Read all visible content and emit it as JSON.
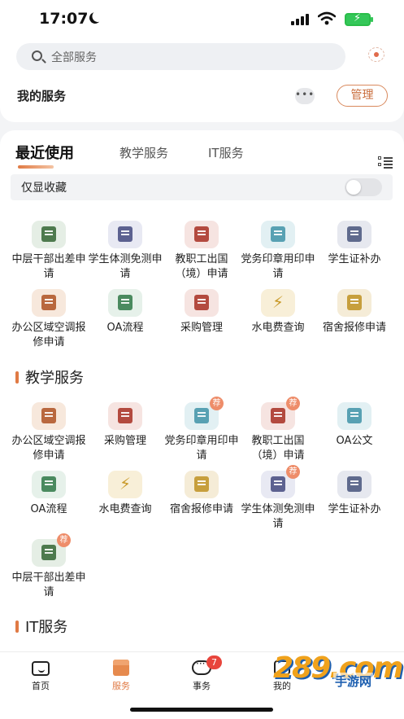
{
  "status_bar": {
    "time": "17:07"
  },
  "search": {
    "placeholder": "全部服务"
  },
  "my_services": {
    "title": "我的服务",
    "more": "•••",
    "manage_label": "管理"
  },
  "tabs": {
    "items": [
      "最近使用",
      "教学服务",
      "IT服务"
    ]
  },
  "favorites_only": {
    "label": "仅显收藏",
    "enabled": false
  },
  "recent": [
    {
      "label": "中层干部出差申请",
      "icon": "business-trip-icon",
      "recommended": false
    },
    {
      "label": "学生体测免测申请",
      "icon": "physical-test-icon",
      "recommended": false
    },
    {
      "label": "教职工出国（境）申请",
      "icon": "airplane-icon",
      "recommended": false
    },
    {
      "label": "党务印章用印申请",
      "icon": "seal-icon",
      "recommended": false
    },
    {
      "label": "学生证补办",
      "icon": "id-card-icon",
      "recommended": false
    },
    {
      "label": "办公区域空调报修申请",
      "icon": "repair-form-icon",
      "recommended": false
    },
    {
      "label": "OA流程",
      "icon": "oa-flow-icon",
      "recommended": false
    },
    {
      "label": "采购管理",
      "icon": "purchase-icon",
      "recommended": false
    },
    {
      "label": "水电费查询",
      "icon": "lightning-icon",
      "recommended": false
    },
    {
      "label": "宿舍报修申请",
      "icon": "dormitory-icon",
      "recommended": false
    }
  ],
  "teaching_section": {
    "title": "教学服务",
    "badge_text": "荐",
    "items": [
      {
        "label": "办公区域空调报修申请",
        "icon": "repair-form-icon",
        "recommended": false
      },
      {
        "label": "采购管理",
        "icon": "purchase-icon",
        "recommended": false
      },
      {
        "label": "党务印章用印申请",
        "icon": "seal-icon",
        "recommended": true
      },
      {
        "label": "教职工出国（境）申请",
        "icon": "airplane-icon",
        "recommended": true
      },
      {
        "label": "OA公文",
        "icon": "oa-document-icon",
        "recommended": false
      },
      {
        "label": "OA流程",
        "icon": "oa-flow-icon",
        "recommended": false
      },
      {
        "label": "水电费查询",
        "icon": "lightning-icon",
        "recommended": false
      },
      {
        "label": "宿舍报修申请",
        "icon": "dormitory-icon",
        "recommended": false
      },
      {
        "label": "学生体测免测申请",
        "icon": "physical-test-icon",
        "recommended": true
      },
      {
        "label": "学生证补办",
        "icon": "id-card-icon",
        "recommended": false
      },
      {
        "label": "中层干部出差申请",
        "icon": "business-trip-icon",
        "recommended": true
      }
    ]
  },
  "it_section": {
    "title": "IT服务"
  },
  "tabbar": {
    "items": [
      "首页",
      "服务",
      "事务",
      "我的"
    ],
    "message_count": "7"
  },
  "watermark": {
    "main": "289.com",
    "sub": "手游网"
  },
  "colors": {
    "accent": "#e07a44",
    "badge": "#e8453c"
  }
}
